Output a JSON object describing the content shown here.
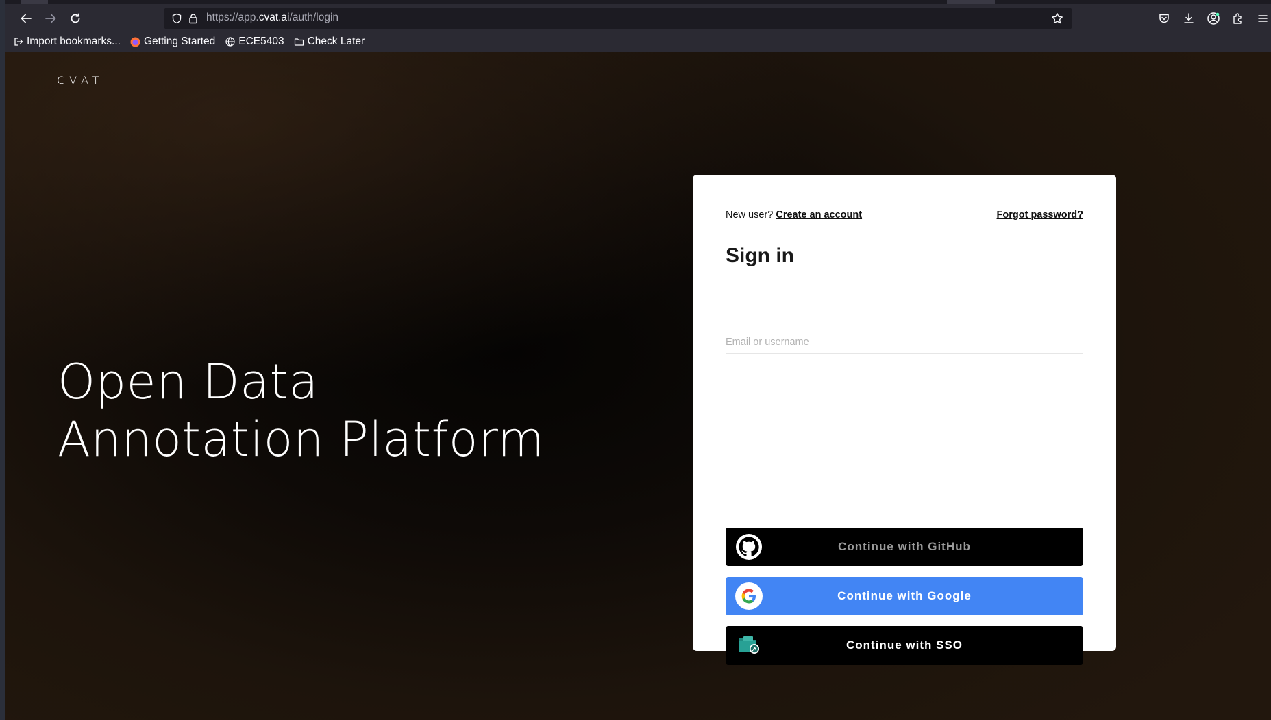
{
  "browser": {
    "url_prefix": "https://app.",
    "url_domain": "cvat.ai",
    "url_path": "/auth/login",
    "bookmarks": [
      {
        "label": "Import bookmarks...",
        "icon": "import-icon"
      },
      {
        "label": "Getting Started",
        "icon": "firefox-icon"
      },
      {
        "label": "ECE5403",
        "icon": "globe-icon"
      },
      {
        "label": "Check Later",
        "icon": "folder-icon"
      }
    ]
  },
  "page": {
    "logo": "CVAT",
    "hero_line1": "Open Data",
    "hero_line2": "Annotation Platform"
  },
  "login": {
    "new_user_text": "New user?",
    "create_account_link": "Create an account",
    "forgot_password_link": "Forgot password?",
    "title": "Sign in",
    "username_placeholder": "Email or username",
    "username_value": "",
    "github_button": "Continue with GitHub",
    "google_button": "Continue with Google",
    "sso_button": "Continue with SSO"
  },
  "colors": {
    "google_blue": "#4285f4",
    "button_black": "#000000",
    "card_bg": "#ffffff"
  }
}
